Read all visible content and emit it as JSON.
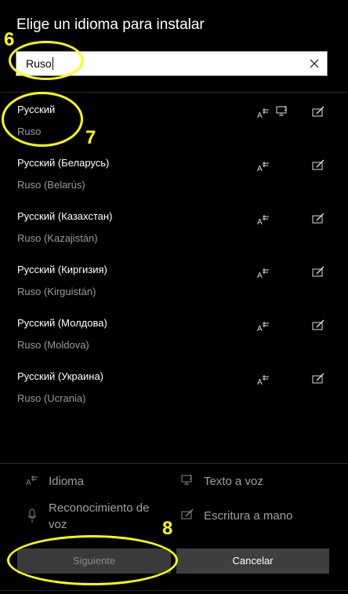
{
  "dialog": {
    "title": "Elige un idioma para instalar"
  },
  "search": {
    "value": "Ruso"
  },
  "languages": [
    {
      "name": "Русский",
      "local": "Ruso",
      "features": [
        "language-pack-icon",
        "text-to-speech-icon",
        "handwriting-icon"
      ]
    },
    {
      "name": "Русский (Беларусь)",
      "local": "Ruso (Belarús)",
      "features": [
        "language-pack-icon",
        "handwriting-icon"
      ]
    },
    {
      "name": "Русский (Казахстан)",
      "local": "Ruso (Kazajistán)",
      "features": [
        "language-pack-icon",
        "handwriting-icon"
      ]
    },
    {
      "name": "Русский (Киргизия)",
      "local": "Ruso (Kirguistán)",
      "features": [
        "language-pack-icon",
        "handwriting-icon"
      ]
    },
    {
      "name": "Русский (Молдова)",
      "local": "Ruso (Moldova)",
      "features": [
        "language-pack-icon",
        "handwriting-icon"
      ]
    },
    {
      "name": "Русский (Украина)",
      "local": "Ruso (Ucrania)",
      "features": [
        "language-pack-icon",
        "handwriting-icon"
      ]
    }
  ],
  "legend": {
    "idioma": "Idioma",
    "text_to_speech": "Texto a voz",
    "speech_recognition_line1": "Reconocimiento de",
    "speech_recognition_line2": "voz",
    "handwriting": "Escritura a mano"
  },
  "buttons": {
    "next": "Siguiente",
    "cancel": "Cancelar"
  },
  "annotations": {
    "step6": "6",
    "step7": "7",
    "step8": "8",
    "color": "#ffff00"
  }
}
